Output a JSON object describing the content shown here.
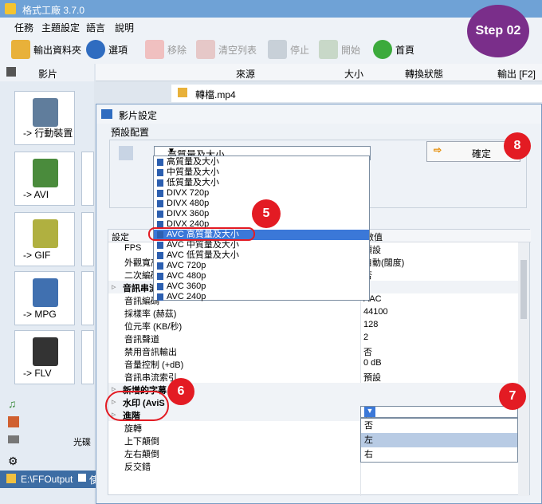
{
  "app": {
    "title": "格式工廠 3.7.0"
  },
  "menu": [
    "任務",
    "主題設定",
    "語言",
    "說明"
  ],
  "toolbar": {
    "output_folder": "輸出資料夾",
    "options": "選項",
    "remove": "移除",
    "clear_list": "清空列表",
    "stop": "停止",
    "start": "開始",
    "home": "首頁"
  },
  "step_badge": "Step 02",
  "sidebar": {
    "header": "影片",
    "items": [
      "-> 行動裝置",
      "-> AVI",
      "-> GIF",
      "-> MPG",
      "-> FLV"
    ]
  },
  "columns": [
    "來源",
    "大小",
    "轉換狀態",
    "輸出 [F2]"
  ],
  "file_row": "轉檔.mp4",
  "bottom": {
    "path": "E:\\FFOutput",
    "disc_label": "光碟",
    "check": "使"
  },
  "dialog": {
    "title": "影片設定",
    "close": "×",
    "preset_label": "預設配置",
    "combo_value": "高質量及大小",
    "ok_button": "確定",
    "dropdown": [
      "高質量及大小",
      "中質量及大小",
      "低質量及大小",
      "DIVX 720p",
      "DIVX 480p",
      "DIVX 360p",
      "DIVX 240p",
      "AVC 高質量及大小",
      "AVC 中質量及大小",
      "AVC 低質量及大小",
      "AVC 720p",
      "AVC 480p",
      "AVC 360p",
      "AVC 240p"
    ],
    "dropdown_selected": 7,
    "grid_header": [
      "設定",
      "數值"
    ],
    "rows": [
      {
        "n": "FPS",
        "v": "預設",
        "cat": false
      },
      {
        "n": "外觀寬高",
        "v": "自動(闊度)",
        "cat": false
      },
      {
        "n": "二次編碼",
        "v": "否",
        "cat": false
      },
      {
        "n": "音訊串流",
        "v": "",
        "cat": true
      },
      {
        "n": "音訊編碼",
        "v": "AAC",
        "cat": false
      },
      {
        "n": "採樣率 (赫茲)",
        "v": "44100",
        "cat": false
      },
      {
        "n": "位元率 (KB/秒)",
        "v": "128",
        "cat": false
      },
      {
        "n": "音訊聲道",
        "v": "2",
        "cat": false
      },
      {
        "n": "禁用音訊輸出",
        "v": "否",
        "cat": false
      },
      {
        "n": "音量控制 (+dB)",
        "v": "0 dB",
        "cat": false
      },
      {
        "n": "音訊串流索引",
        "v": "預設",
        "cat": false
      },
      {
        "n": "新增的字幕",
        "v": "",
        "cat": true
      },
      {
        "n": "水印 (AviS",
        "v": "",
        "cat": true
      },
      {
        "n": "進階",
        "v": "",
        "cat": true
      },
      {
        "n": "旋轉",
        "v": "否",
        "cat": false
      },
      {
        "n": "上下顛倒",
        "v": "",
        "cat": false
      },
      {
        "n": "左右顛倒",
        "v": "",
        "cat": false
      },
      {
        "n": "反交錯",
        "v": "",
        "cat": false
      }
    ],
    "rotate_options": [
      "否",
      "左",
      "右"
    ],
    "rotate_selected": 1
  },
  "callouts": [
    "5",
    "6",
    "7",
    "8"
  ],
  "colors": {
    "accent": "#e31b23",
    "step": "#7a2e8a",
    "select": "#3b78d8"
  }
}
